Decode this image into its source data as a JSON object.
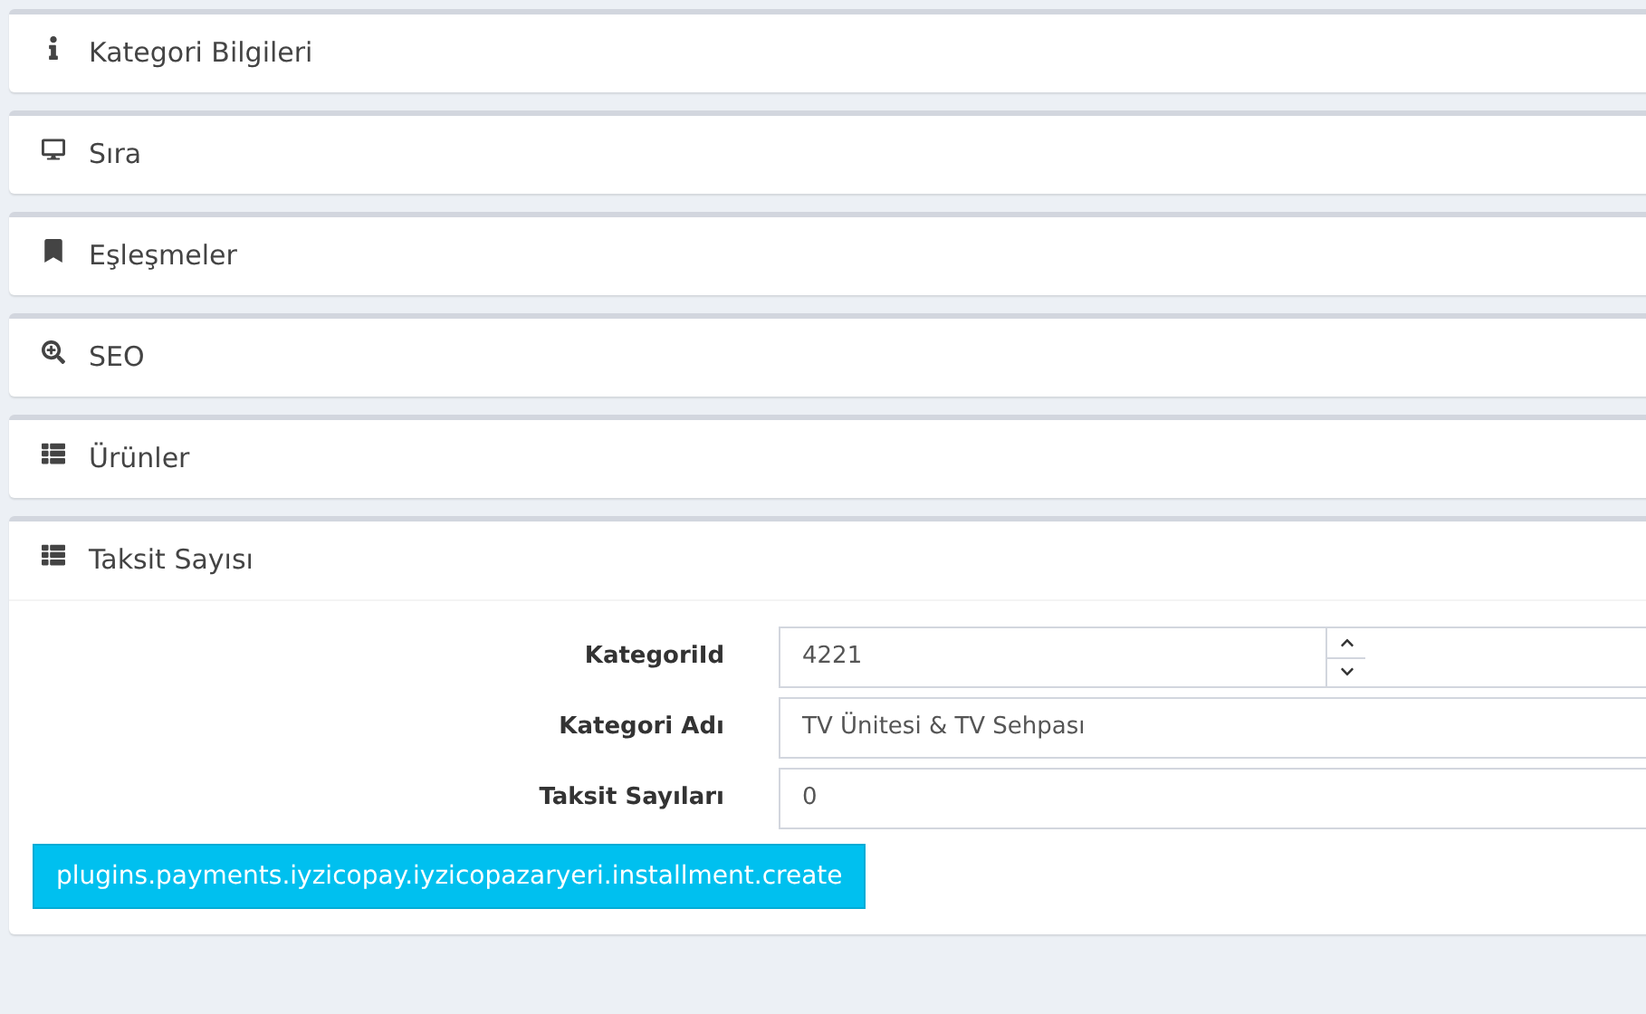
{
  "panels": [
    {
      "title": "Kategori Bilgileri",
      "expanded": false
    },
    {
      "title": "Sıra",
      "expanded": false
    },
    {
      "title": "Eşleşmeler",
      "expanded": false
    },
    {
      "title": "SEO",
      "expanded": false
    },
    {
      "title": "Ürünler",
      "expanded": false
    },
    {
      "title": "Taksit Sayısı",
      "expanded": true,
      "fields": [
        {
          "label": "KategoriId",
          "value": "4221",
          "kind": "number"
        },
        {
          "label": "Kategori Adı",
          "value": "TV Ünitesi & TV Sehpası",
          "kind": "text"
        },
        {
          "label": "Taksit Sayıları",
          "value": "0",
          "kind": "text"
        }
      ],
      "button": "plugins.payments.iyzicopay.iyzicopazaryeri.installment.create"
    }
  ]
}
